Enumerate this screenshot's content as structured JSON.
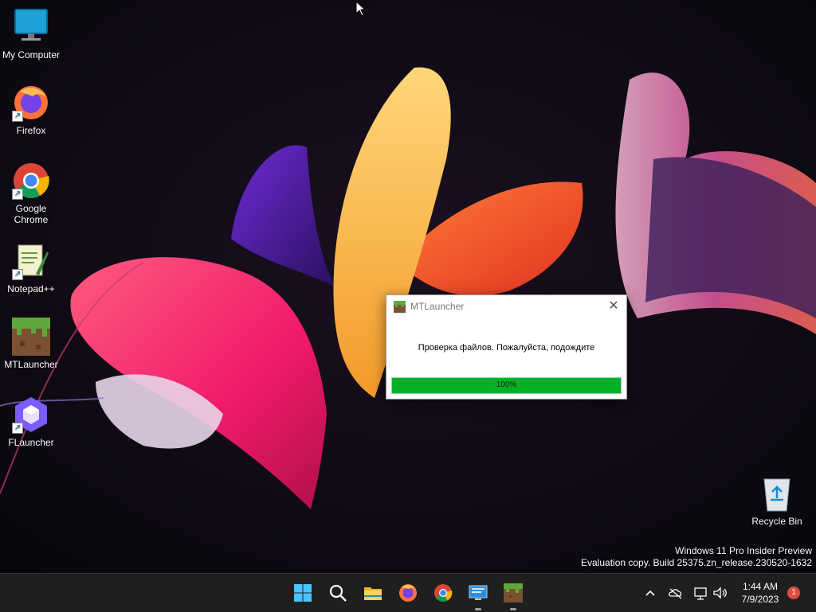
{
  "desktop": {
    "icons": [
      {
        "label": "My Computer"
      },
      {
        "label": "Firefox"
      },
      {
        "label": "Google\nChrome"
      },
      {
        "label": "Notepad++"
      },
      {
        "label": "MTLauncher"
      },
      {
        "label": "FLauncher"
      },
      {
        "label": "Recycle Bin"
      }
    ]
  },
  "dialog": {
    "title": "MTLauncher",
    "close_icon": "close-icon",
    "message": "Проверка файлов. Пожалуйста, подождите",
    "progress_text": "100%",
    "progress_fraction": 1.0,
    "progress_color": "#06b025"
  },
  "watermark": {
    "line1": "Windows 11 Pro Insider Preview",
    "line2": "Evaluation copy. Build 25375.zn_release.230520-1632"
  },
  "taskbar": {
    "apps": [
      "start-icon",
      "search-icon",
      "file-explorer-icon",
      "firefox-icon",
      "chrome-icon",
      "remote-desktop-icon",
      "mtlauncher-icon"
    ],
    "tray_icons": [
      "chevron-up-icon",
      "onedrive-offline-icon",
      "network-icon",
      "volume-icon"
    ],
    "time": "1:44 AM",
    "date": "7/9/2023",
    "notification_count": "1"
  }
}
